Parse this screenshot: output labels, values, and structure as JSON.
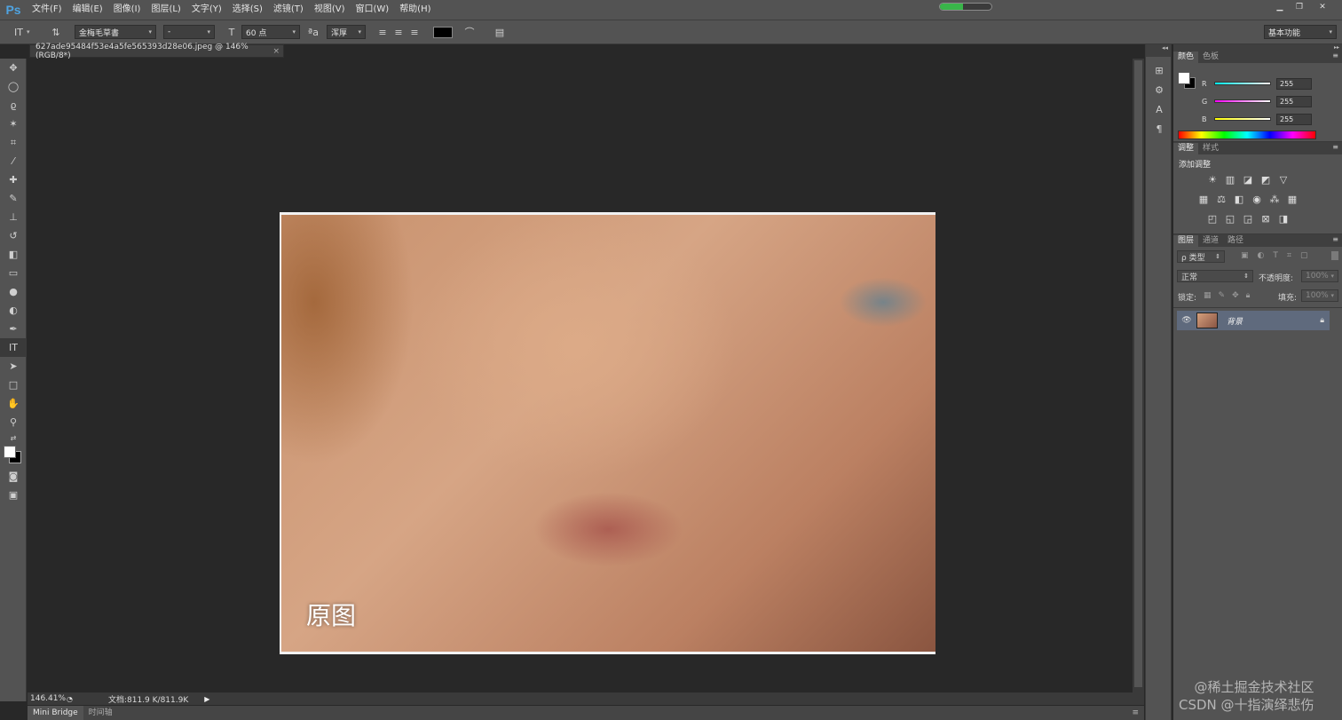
{
  "app": {
    "logo": "Ps"
  },
  "menu": [
    "文件(F)",
    "编辑(E)",
    "图像(I)",
    "图层(L)",
    "文字(Y)",
    "选择(S)",
    "滤镜(T)",
    "视图(V)",
    "窗口(W)",
    "帮助(H)"
  ],
  "progress": {
    "fraction": 0.45,
    "color": "#39b54a"
  },
  "options": {
    "font_family": "金梅毛草書",
    "font_style": "-",
    "font_size": "60 点",
    "antialias": "浑厚",
    "text_color": "#000000",
    "workspace": "基本功能"
  },
  "document": {
    "tab_title": "627ade95484f53e4a5fe565393d28e06.jpeg @ 146%(RGB/8*)",
    "caption": "原图"
  },
  "status": {
    "zoom": "146.41%",
    "doc_info": "文档:811.9 K/811.9K"
  },
  "bottom_tabs": [
    "Mini Bridge",
    "时间轴"
  ],
  "color_panel": {
    "tabs": [
      "颜色",
      "色板"
    ],
    "r_label": "R",
    "g_label": "G",
    "b_label": "B",
    "r": "255",
    "g": "255",
    "b": "255"
  },
  "adjust_panel": {
    "tabs": [
      "调整",
      "样式"
    ],
    "title": "添加调整"
  },
  "layers_panel": {
    "tabs": [
      "图层",
      "通道",
      "路径"
    ],
    "filter": "ρ 类型",
    "blend_mode": "正常",
    "opacity_label": "不透明度:",
    "opacity_value": "100%",
    "lock_label": "锁定:",
    "fill_label": "填充:",
    "fill_value": "100%",
    "layer_name": "背景"
  },
  "watermark": {
    "line1": "@稀土掘金技术社区",
    "line2": "CSDN @十指演绎悲伤"
  }
}
